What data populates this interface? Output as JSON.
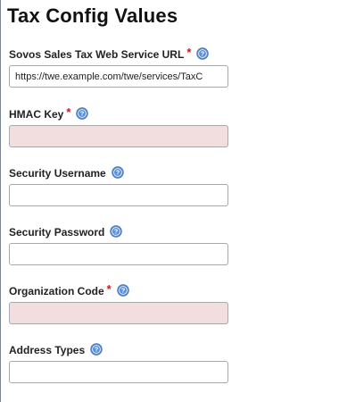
{
  "page": {
    "title": "Tax Config Values"
  },
  "fields": [
    {
      "label": "Sovos Sales Tax Web Service URL",
      "required": true,
      "value": "https://twe.example.com/twe/services/TaxC",
      "placeholder": ""
    },
    {
      "label": "HMAC Key",
      "required": true,
      "value": "",
      "placeholder": ""
    },
    {
      "label": "Security Username",
      "required": false,
      "value": "",
      "placeholder": ""
    },
    {
      "label": "Security Password",
      "required": false,
      "value": "",
      "placeholder": ""
    },
    {
      "label": "Organization Code",
      "required": true,
      "value": "",
      "placeholder": ""
    },
    {
      "label": "Address Types",
      "required": false,
      "value": "",
      "placeholder": ""
    }
  ],
  "required_marker": "*",
  "icons": {
    "help": "help-icon"
  },
  "colors": {
    "required_star": "#d4141b",
    "required_empty_bg": "#f2dede",
    "help_icon_fill": "#5b8fd6"
  }
}
